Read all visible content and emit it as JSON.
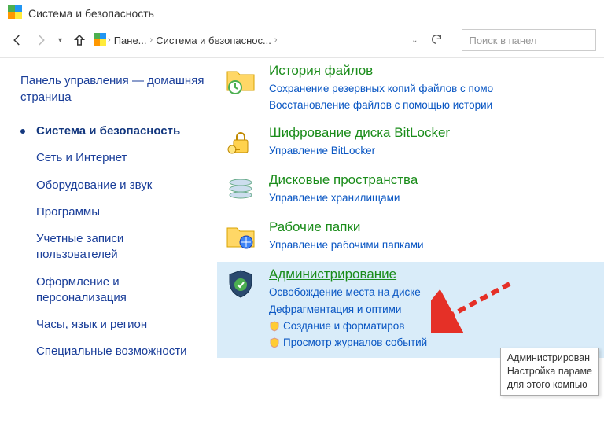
{
  "window": {
    "title": "Система и безопасность"
  },
  "nav": {
    "breadcrumb": {
      "c1": "Пане...",
      "c2": "Система и безопаснос..."
    },
    "search_placeholder": "Поиск в панел"
  },
  "sidebar": {
    "home": "Панель управления — домашняя страница",
    "items": [
      {
        "label": "Система и безопасность",
        "active": true
      },
      {
        "label": "Сеть и Интернет"
      },
      {
        "label": "Оборудование и звук"
      },
      {
        "label": "Программы"
      },
      {
        "label": "Учетные записи пользователей"
      },
      {
        "label": "Оформление и персонализация"
      },
      {
        "label": "Часы, язык и регион"
      },
      {
        "label": "Специальные возможности"
      }
    ]
  },
  "categories": [
    {
      "title": "История файлов",
      "icon": "folder-clock",
      "links": [
        "Сохранение резервных копий файлов с помо",
        "Восстановление файлов с помощью истории"
      ]
    },
    {
      "title": "Шифрование диска BitLocker",
      "icon": "lock-key",
      "links": [
        "Управление BitLocker"
      ]
    },
    {
      "title": "Дисковые пространства",
      "icon": "disks",
      "links": [
        "Управление хранилищами"
      ]
    },
    {
      "title": "Рабочие папки",
      "icon": "folder-net",
      "links": [
        "Управление рабочими папками"
      ]
    },
    {
      "title": "Администрирование",
      "icon": "shield-check",
      "highlight": true,
      "underlined": true,
      "links": [
        "Освобождение места на диске",
        "Дефрагментация и оптими"
      ],
      "shield_links": [
        "Создание и форматиров",
        "Просмотр журналов событий"
      ]
    }
  ],
  "tooltip": {
    "line1": "Администрирован",
    "line2": "Настройка параме",
    "line3": "для этого компью"
  }
}
